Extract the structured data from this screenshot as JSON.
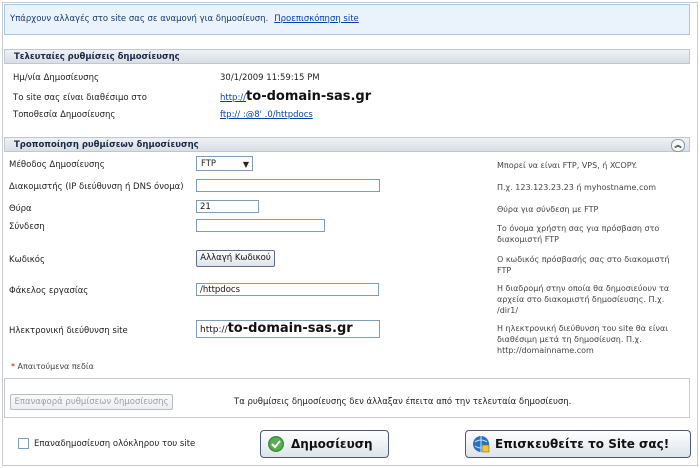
{
  "alert": {
    "message": "Υπάρχουν αλλαγές στο site σας σε αναμονή για δημοσίευση.",
    "link": "Προεπισκόπηση site"
  },
  "last_settings": {
    "header": "Τελευταίες ρυθμίσεις δημοσίευσης",
    "rows": [
      {
        "label": "Ημ/νία Δημοσίευσης",
        "value": "30/1/2009 11:59:15 PM"
      },
      {
        "label": "Το site σας είναι διαθέσιμο στο",
        "prefix": "http://",
        "domain": "to-domain-sas.gr"
      },
      {
        "label": "Τοποθεσία Δημοσίευσης",
        "value": "ftp://                    :@8'                 .0/httpdocs"
      }
    ]
  },
  "modify": {
    "header": "Τροποποίηση ρυθμίσεων δημοσίευσης",
    "collapse_icon": "chevron-double-up-icon",
    "method": {
      "label": "Μέθοδος Δημοσίευσης",
      "value": "FTP",
      "hint": "Μπορεί να είναι FTP, VPS, ή XCOPY."
    },
    "server": {
      "label": "Διακομιστής (IP διεύθυνση ή DNS όνομα)",
      "value": "",
      "hint": "Π.χ. 123.123.23.23 ή myhostname.com"
    },
    "port": {
      "label": "Θύρα",
      "value": "21",
      "hint": "Θύρα για σύνδεση με FTP"
    },
    "login": {
      "label": "Σύνδεση",
      "value": "",
      "hint": "Το όνομα χρήστη σας για πρόσβαση στο διακομιστή FTP"
    },
    "password": {
      "label": "Κωδικός",
      "button": "Αλλαγή Κωδικού",
      "hint": "Ο κωδικός πρόσβασής σας στο διακομιστή FTP"
    },
    "folder": {
      "label": "Φάκελος εργασίας",
      "value": "/httpdocs",
      "hint": "Η διαδρομή στην οποία θα δημοσιεύουν τα αρχεία στο διακομιστή δημοσίευσης. Π.χ. /dir1/"
    },
    "site_url": {
      "label": "Ηλεκτρονική διεύθυνση site",
      "prefix": "http://",
      "domain": "to-domain-sas.gr",
      "hint": "Η ηλεκτρονική διεύθυνση του site θα είναι διαθέσιμη μετά τη δημοσίευση. Π.χ. http://domainname.com"
    },
    "required_note": "Απαιτούμενα πεδία",
    "required_mark": "*"
  },
  "bottom": {
    "restore_button": "Επαναφορά ρυθμίσεων δημοσίευσης",
    "status": "Τα ρυθμίσεις δημοσίευσης δεν άλλαξαν έπειτα από την τελευταία δημοσίευση.",
    "republish_checkbox": "Επαναδημοσίευση ολόκληρου του site",
    "publish_button": "Δημοσίευση",
    "visit_button": "Επισκευθείτε το Site σας!"
  }
}
